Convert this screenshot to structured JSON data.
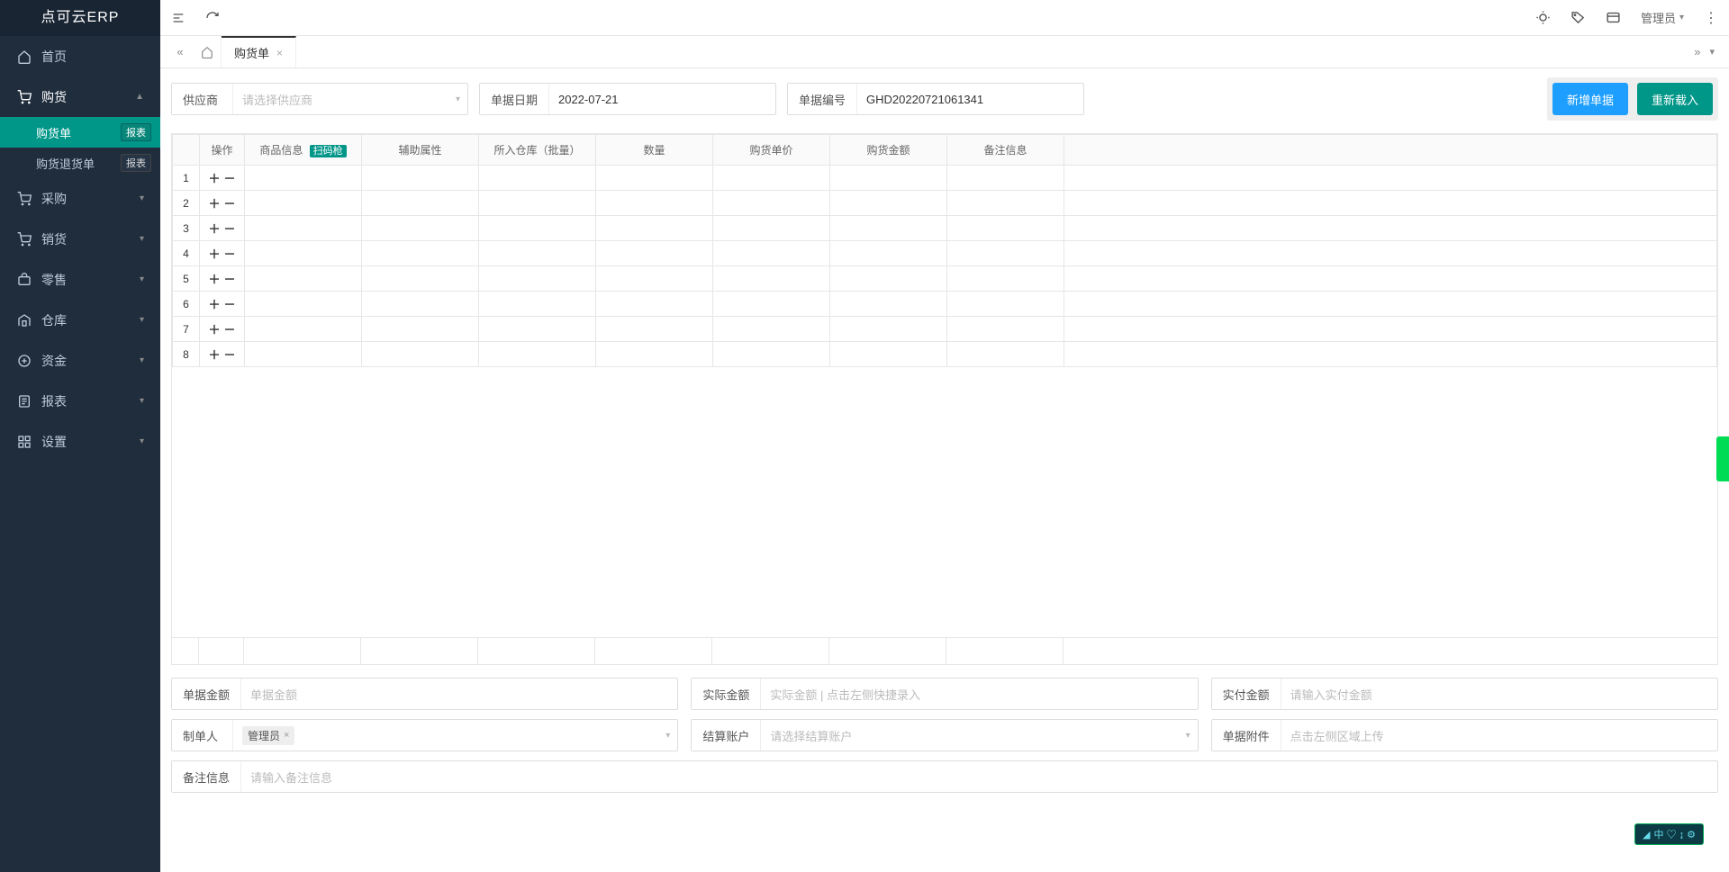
{
  "app": {
    "title": "点可云ERP"
  },
  "sidebar": {
    "items": [
      {
        "icon": "home",
        "label": "首页",
        "expandable": false
      },
      {
        "icon": "cart",
        "label": "购货",
        "expandable": true,
        "expanded": true,
        "children": [
          {
            "label": "购货单",
            "badge": "报表",
            "active": true
          },
          {
            "label": "购货退货单",
            "badge": "报表",
            "active": false
          }
        ]
      },
      {
        "icon": "cart",
        "label": "采购",
        "expandable": true
      },
      {
        "icon": "cart",
        "label": "销货",
        "expandable": true
      },
      {
        "icon": "retail",
        "label": "零售",
        "expandable": true
      },
      {
        "icon": "warehouse",
        "label": "仓库",
        "expandable": true
      },
      {
        "icon": "fund",
        "label": "资金",
        "expandable": true
      },
      {
        "icon": "report",
        "label": "报表",
        "expandable": true
      },
      {
        "icon": "settings",
        "label": "设置",
        "expandable": true
      }
    ]
  },
  "topbar": {
    "user_label": "管理员"
  },
  "tabs": {
    "active": {
      "label": "购货单"
    }
  },
  "filters": {
    "supplier": {
      "label": "供应商",
      "placeholder": "请选择供应商"
    },
    "date": {
      "label": "单据日期",
      "value": "2022-07-21"
    },
    "billno": {
      "label": "单据编号",
      "value": "GHD20220721061341"
    }
  },
  "actions": {
    "new_label": "新增单据",
    "reload_label": "重新载入"
  },
  "table": {
    "headers": {
      "op": "操作",
      "product": "商品信息",
      "scan": "扫码枪",
      "attr": "辅助属性",
      "warehouse": "所入仓库（批量）",
      "qty": "数量",
      "price": "购货单价",
      "amount": "购货金额",
      "note": "备注信息"
    },
    "rows": [
      1,
      2,
      3,
      4,
      5,
      6,
      7,
      8
    ]
  },
  "footer_form": {
    "bill_amount": {
      "label": "单据金额",
      "placeholder": "单据金额"
    },
    "actual_amount": {
      "label": "实际金额",
      "placeholder": "实际金额 | 点击左侧快捷录入"
    },
    "paid_amount": {
      "label": "实付金额",
      "placeholder": "请输入实付金额"
    },
    "maker": {
      "label": "制单人",
      "tag": "管理员"
    },
    "settle_acct": {
      "label": "结算账户",
      "placeholder": "请选择结算账户"
    },
    "attachment": {
      "label": "单据附件",
      "placeholder": "点击左侧区域上传"
    },
    "remark": {
      "label": "备注信息",
      "placeholder": "请输入备注信息"
    }
  },
  "ime": {
    "text": "中 ♡ ↨ ⚙"
  }
}
